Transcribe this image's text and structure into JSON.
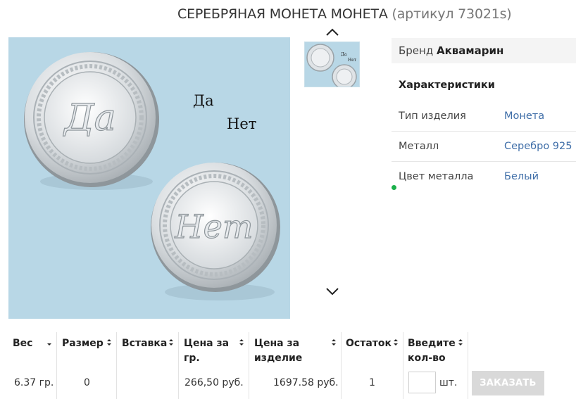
{
  "title": {
    "name": "СЕРЕБРЯНАЯ МОНЕТА МОНЕТА",
    "article": "(артикул 73021s)"
  },
  "main_image": {
    "yes_label": "Да",
    "no_label": "Нет",
    "coin_yes_text": "Да",
    "coin_no_text": "Нет",
    "background_color": "#b8d7e6"
  },
  "thumbnails": {
    "yes_label": "Да",
    "no_label": "Нет"
  },
  "info": {
    "brand_label": "Бренд",
    "brand_value": "Аквамарин",
    "characteristics_title": "Характеристики",
    "characteristics": [
      {
        "key": "Тип изделия",
        "value": "Монета"
      },
      {
        "key": "Металл",
        "value": "Серебро 925"
      },
      {
        "key": "Цвет металла",
        "value": "Белый"
      }
    ]
  },
  "table": {
    "headers": [
      "Вес",
      "Размер",
      "Вставка",
      "Цена за гр.",
      "Цена за изделие",
      "Остаток",
      "Введите кол-во"
    ],
    "row": {
      "weight": "6.37 гр.",
      "size": "0",
      "insert": "",
      "price_per_gram": "266,50 руб.",
      "price_per_item": "1697.58 руб.",
      "stock": "1",
      "quantity": "",
      "unit": "шт."
    },
    "order_button": "ЗАКАЗАТЬ"
  },
  "colors": {
    "link": "#3f6ea8",
    "button_disabled": "#d9d9d9",
    "status_green": "#1bb04a"
  }
}
